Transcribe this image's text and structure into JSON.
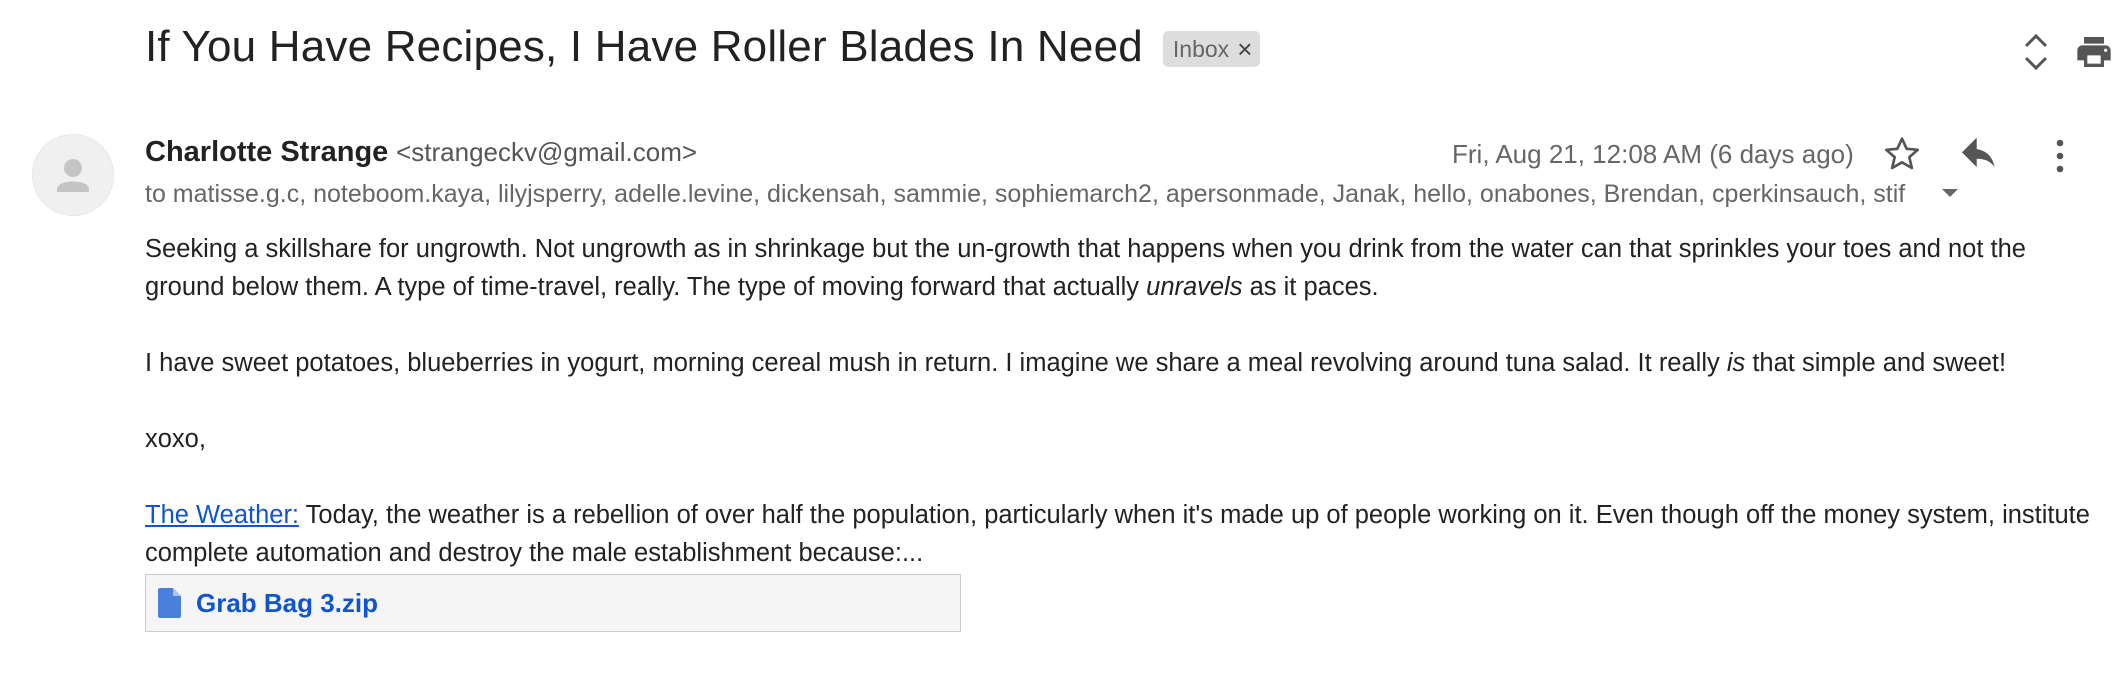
{
  "email": {
    "subject": "If You Have Recipes, I Have Roller Blades In Need",
    "label": "Inbox",
    "label_remove": "×",
    "sender": {
      "name": "Charlotte Strange",
      "email": "<strangeckv@gmail.com>"
    },
    "date": "Fri, Aug 21, 12:08 AM (6 days ago)",
    "recipients": "to matisse.g.c, noteboom.kaya, lilyjsperry, adelle.levine, dickensah, sammie, sophiemarch2, apersonmade, Janak, hello, onabones, Brendan, cperkinsauch, stif",
    "body": {
      "p1_part1": "Seeking a skillshare for ungrowth. Not ungrowth as in shrinkage but the un-growth that happens when you drink from the water can that sprinkles your toes and not the ground below them. A type of time-travel, really. The type of moving forward that actually ",
      "p1_em": "unravels",
      "p1_part2": " as it paces.",
      "p2_part1": "I have sweet potatoes, blueberries in yogurt, morning cereal mush in return. I imagine we share a meal revolving around tuna salad. It really ",
      "p2_em": "is",
      "p2_part2": " that simple and sweet!",
      "p3": "xoxo,",
      "p4_link": "The Weather:",
      "p4_text": " Today, the weather is a rebellion of over half the population, particularly when it's made up of people working on it. Even though off the money system, institute complete automation and destroy the male establishment because:..."
    },
    "attachment": {
      "name": "Grab Bag 3.zip",
      "icon": "file-icon"
    }
  },
  "icons": {
    "expand": "expand-collapse-icon",
    "print": "print-icon",
    "star": "star-icon",
    "reply": "reply-icon",
    "more": "more-vert-icon",
    "avatar": "person-icon",
    "dropdown": "caret-down-icon"
  },
  "colors": {
    "link": "#1155cc",
    "label_chip": "#dddddd",
    "secondary_text": "#666666"
  }
}
